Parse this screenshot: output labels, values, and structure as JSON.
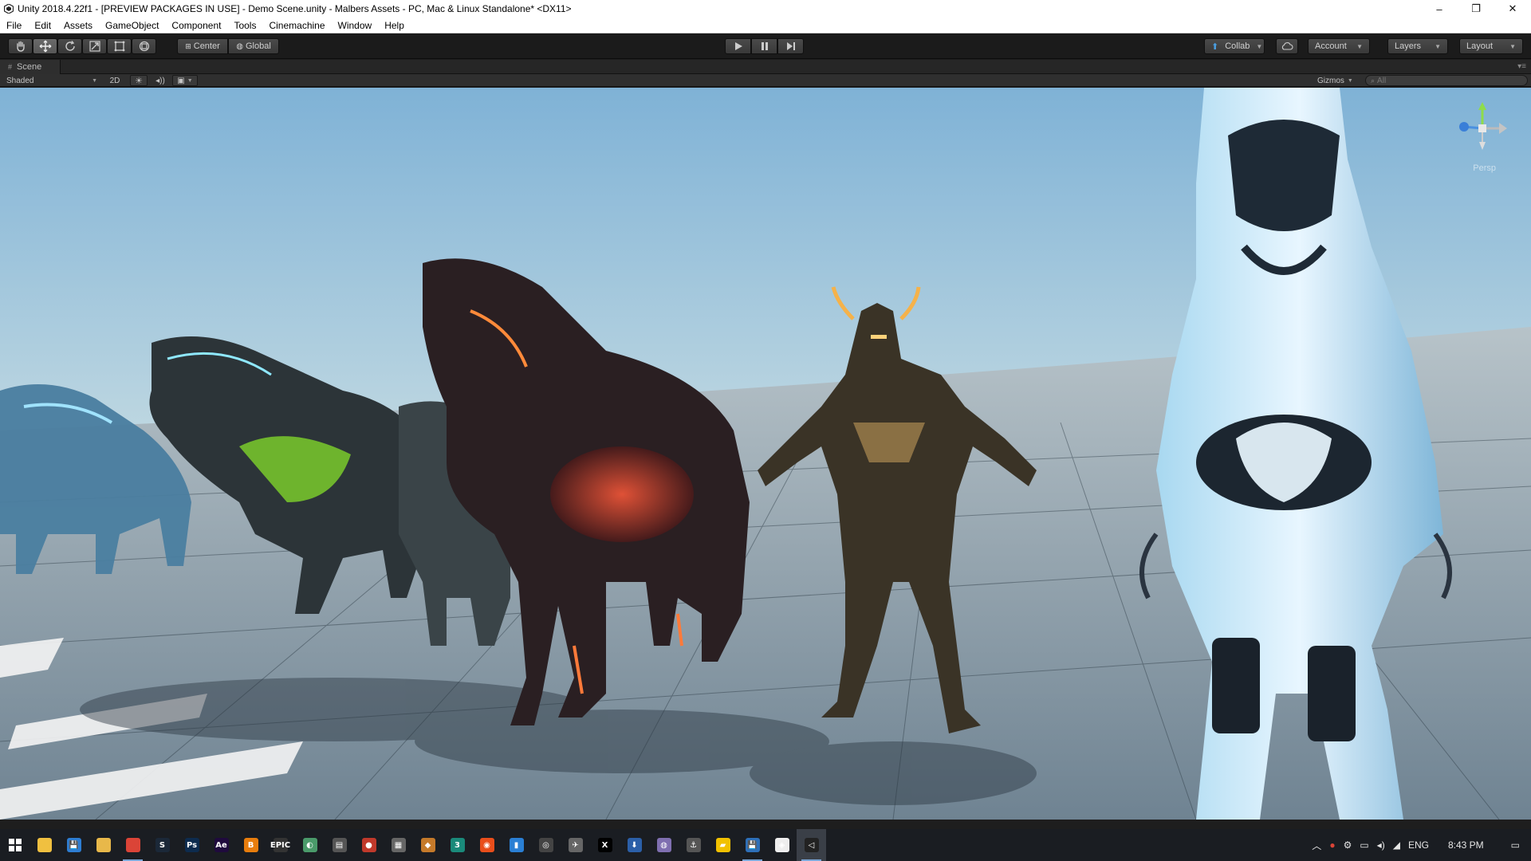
{
  "window": {
    "title": "Unity 2018.4.22f1 - [PREVIEW PACKAGES IN USE] - Demo Scene.unity - Malbers Assets - PC, Mac & Linux Standalone* <DX11>",
    "controls": {
      "minimize": "–",
      "maximize": "❐",
      "close": "✕"
    }
  },
  "menu": [
    "File",
    "Edit",
    "Assets",
    "GameObject",
    "Component",
    "Tools",
    "Cinemachine",
    "Window",
    "Help"
  ],
  "toolbar": {
    "tools": [
      "hand-icon",
      "move-icon",
      "rotate-icon",
      "scale-icon",
      "rect-icon",
      "transform-icon"
    ],
    "pivot": {
      "center": "Center",
      "global": "Global"
    },
    "collab": "Collab",
    "account": "Account",
    "layers": "Layers",
    "layout": "Layout"
  },
  "scene_tab": {
    "label": "Scene"
  },
  "scene_bar": {
    "shading": "Shaded",
    "mode2d": "2D",
    "gizmos": "Gizmos",
    "search_placeholder": "All"
  },
  "viewport": {
    "persp_label": "Persp"
  },
  "taskbar": {
    "apps": [
      {
        "name": "file-explorer",
        "label": "",
        "color": "#f0c040",
        "open": false
      },
      {
        "name": "save-app",
        "label": "💾",
        "color": "#2d7dd2",
        "open": false
      },
      {
        "name": "folder",
        "label": "",
        "color": "#e8b84a",
        "open": false
      },
      {
        "name": "chrome",
        "label": "",
        "color": "#db4437",
        "open": true
      },
      {
        "name": "steam",
        "label": "S",
        "color": "#1b2838",
        "open": false
      },
      {
        "name": "photoshop",
        "label": "Ps",
        "color": "#0d2b4e",
        "open": false
      },
      {
        "name": "after-effects",
        "label": "Ae",
        "color": "#1f0a3d",
        "open": false
      },
      {
        "name": "blender",
        "label": "B",
        "color": "#e87d0d",
        "open": false
      },
      {
        "name": "epic",
        "label": "EPIC",
        "color": "#333333",
        "open": false
      },
      {
        "name": "app-9",
        "label": "◐",
        "color": "#4a9a6a",
        "open": false
      },
      {
        "name": "app-10",
        "label": "▤",
        "color": "#555555",
        "open": false
      },
      {
        "name": "app-11",
        "label": "●",
        "color": "#c0392b",
        "open": false
      },
      {
        "name": "calculator",
        "label": "▦",
        "color": "#666666",
        "open": false
      },
      {
        "name": "app-13",
        "label": "◆",
        "color": "#c57a2a",
        "open": false
      },
      {
        "name": "app-14",
        "label": "3",
        "color": "#1a8a7a",
        "open": false
      },
      {
        "name": "app-15",
        "label": "◉",
        "color": "#e94e1b",
        "open": false
      },
      {
        "name": "app-16",
        "label": "▮",
        "color": "#2a7fd4",
        "open": false
      },
      {
        "name": "app-17",
        "label": "◎",
        "color": "#444444",
        "open": false
      },
      {
        "name": "app-18",
        "label": "✈",
        "color": "#666666",
        "open": false
      },
      {
        "name": "app-19",
        "label": "X",
        "color": "#000000",
        "open": false
      },
      {
        "name": "app-20",
        "label": "⬇",
        "color": "#2b5fa8",
        "open": false
      },
      {
        "name": "app-21",
        "label": "◍",
        "color": "#7f6fb0",
        "open": false
      },
      {
        "name": "app-22",
        "label": "⚓",
        "color": "#555555",
        "open": false
      },
      {
        "name": "app-23",
        "label": "▰",
        "color": "#f2c100",
        "open": false
      },
      {
        "name": "app-24",
        "label": "💾",
        "color": "#2d6fb8",
        "open": true
      },
      {
        "name": "app-25",
        "label": "◈",
        "color": "#eeeeee",
        "open": false
      },
      {
        "name": "unity",
        "label": "◁",
        "color": "#222222",
        "open": true
      }
    ],
    "tray": {
      "language": "ENG",
      "time": "8:43 PM"
    }
  }
}
